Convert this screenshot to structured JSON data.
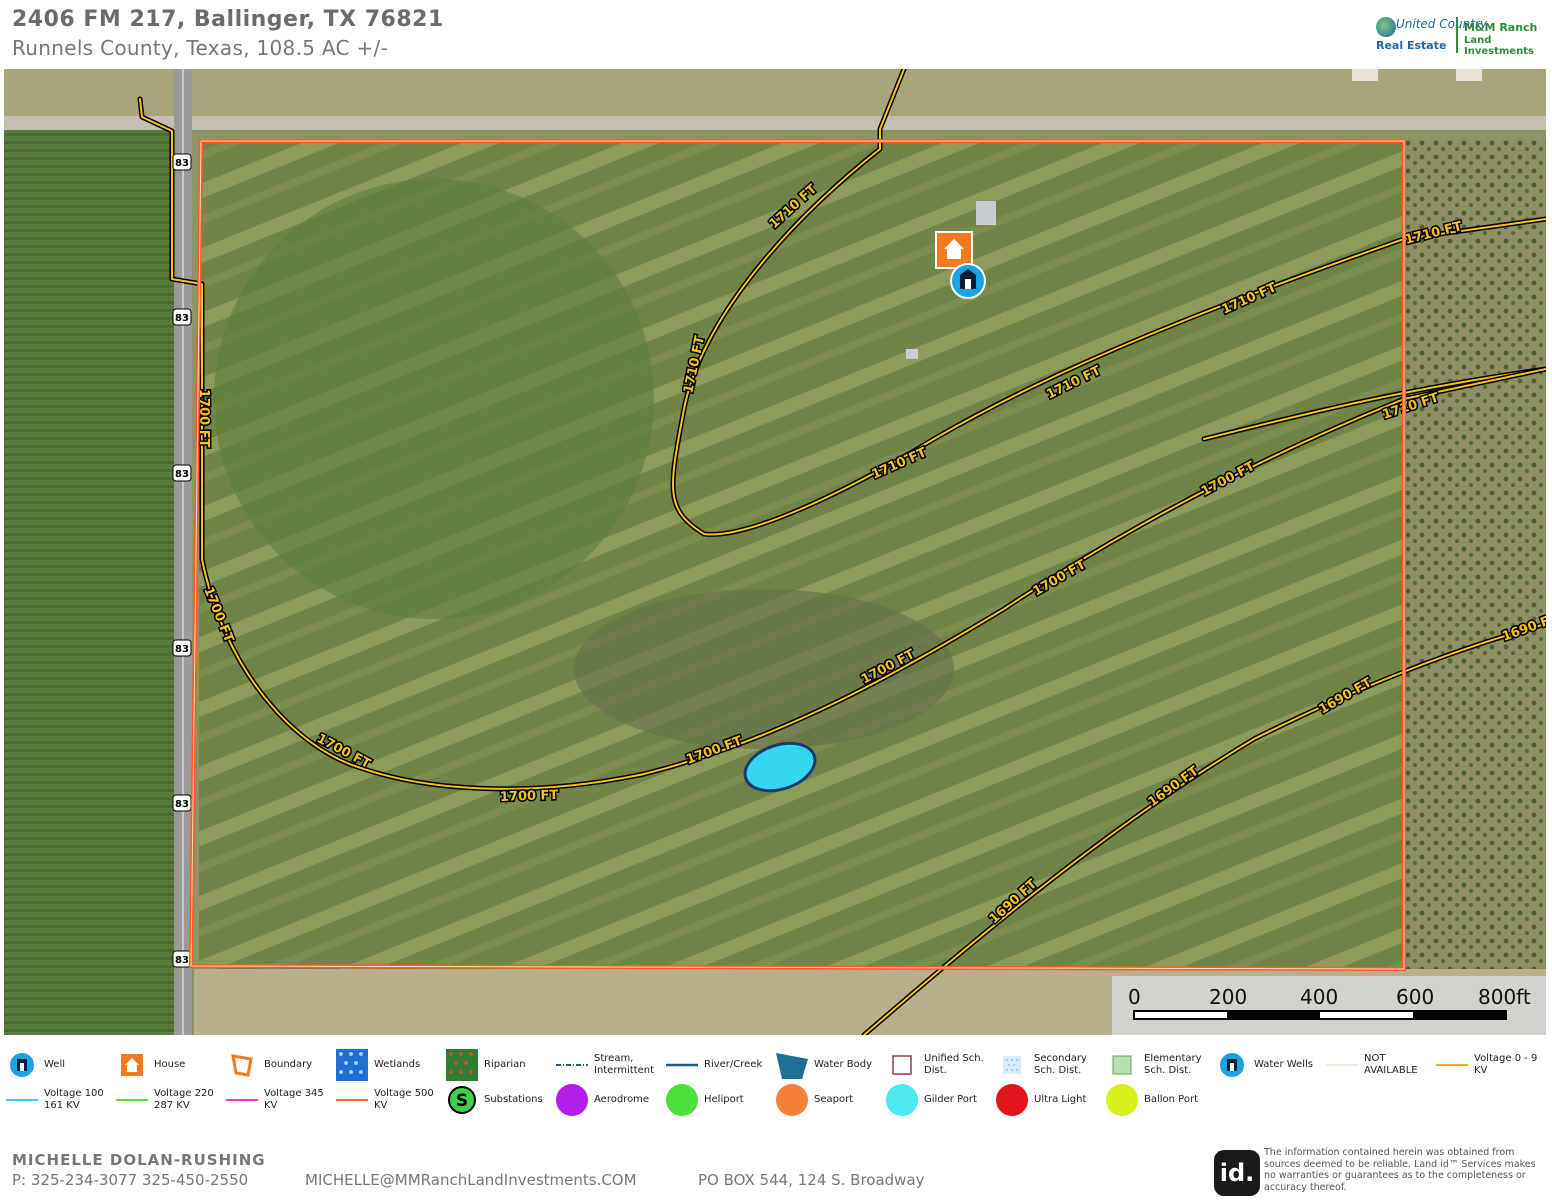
{
  "header": {
    "title": "2406 FM 217, Ballinger, TX 76821",
    "subtitle": "Runnels County, Texas, 108.5 AC +/-"
  },
  "logo": {
    "line1": "United Country",
    "line2": "Real Estate",
    "partner1": "M&M Ranch",
    "partner2": "Land Investments"
  },
  "map": {
    "contours": [
      {
        "label": "1710 FT"
      },
      {
        "label": "1700 FT"
      },
      {
        "label": "1690 FT"
      }
    ],
    "highway_shield": "83",
    "scale": {
      "ticks": [
        "0",
        "200",
        "400",
        "600",
        "800ft"
      ]
    },
    "colors": {
      "boundary": "#ff5a1f",
      "contour": "#f7c21b",
      "water": "#35d6f2",
      "house": "#f47a20",
      "well": "#1aa3e0"
    }
  },
  "legend": [
    {
      "label": "Well",
      "icon": "well-icon"
    },
    {
      "label": "House",
      "icon": "house-icon"
    },
    {
      "label": "Boundary",
      "icon": "boundary-icon"
    },
    {
      "label": "Wetlands",
      "icon": "wetlands-icon"
    },
    {
      "label": "Riparian",
      "icon": "riparian-icon"
    },
    {
      "label": "Stream, Intermittent",
      "icon": "stream-icon"
    },
    {
      "label": "River/Creek",
      "icon": "river-icon"
    },
    {
      "label": "Water Body",
      "icon": "water-body-icon"
    },
    {
      "label": "Unified Sch. Dist.",
      "icon": "unified-school-icon"
    },
    {
      "label": "Secondary Sch. Dist.",
      "icon": "secondary-school-icon"
    },
    {
      "label": "Elementary Sch. Dist.",
      "icon": "elementary-school-icon"
    },
    {
      "label": "Water Wells",
      "icon": "water-wells-icon"
    },
    {
      "label": "NOT AVAILABLE",
      "icon": "not-available-icon"
    },
    {
      "label": "Voltage 0 - 9 KV",
      "icon": "voltage-0-9-icon"
    },
    {
      "label": "Voltage 100 161 KV",
      "icon": "voltage-100-icon"
    },
    {
      "label": "Voltage 220 287 KV",
      "icon": "voltage-220-icon"
    },
    {
      "label": "Voltage 345 KV",
      "icon": "voltage-345-icon"
    },
    {
      "label": "Voltage 500 KV",
      "icon": "voltage-500-icon"
    },
    {
      "label": "Substations",
      "icon": "substation-icon"
    },
    {
      "label": "Aerodrome",
      "icon": "aerodrome-icon"
    },
    {
      "label": "Heliport",
      "icon": "heliport-icon"
    },
    {
      "label": "Seaport",
      "icon": "seaport-icon"
    },
    {
      "label": "Gilder Port",
      "icon": "glider-port-icon"
    },
    {
      "label": "Ultra Light",
      "icon": "ultra-light-icon"
    },
    {
      "label": "Ballon Port",
      "icon": "balloon-port-icon"
    }
  ],
  "footer": {
    "name": "MICHELLE  DOLAN-RUSHING",
    "phone": "P: 325-234-3077 325-450-2550",
    "email": "MICHELLE@MMRanchLandInvestments.COM",
    "address": "PO BOX 544, 124 S. Broadway",
    "id_logo": "id.",
    "disclaimer": "The information contained herein was obtained from sources deemed to be reliable. Land id™ Services makes no warranties or guarantees as to the completeness or accuracy thereof."
  }
}
